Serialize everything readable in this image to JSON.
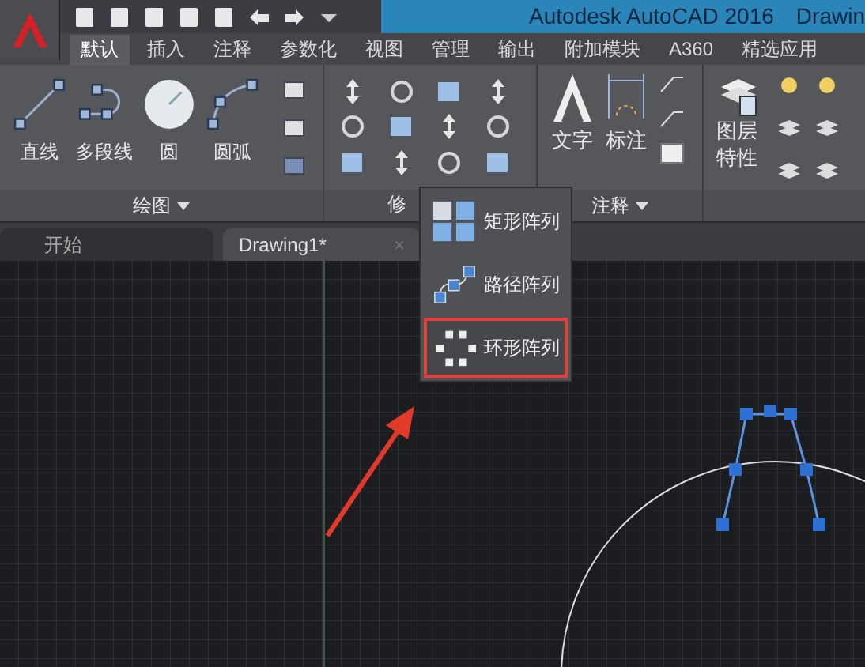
{
  "title_bar": {
    "title": "Autodesk AutoCAD 2016",
    "document": "Drawin"
  },
  "ribbon_tabs": [
    {
      "label": "默认",
      "selected": true
    },
    {
      "label": "插入",
      "selected": false
    },
    {
      "label": "注释",
      "selected": false
    },
    {
      "label": "参数化",
      "selected": false
    },
    {
      "label": "视图",
      "selected": false
    },
    {
      "label": "管理",
      "selected": false
    },
    {
      "label": "输出",
      "selected": false
    },
    {
      "label": "附加模块",
      "selected": false
    },
    {
      "label": "A360",
      "selected": false
    },
    {
      "label": "精选应用",
      "selected": false
    }
  ],
  "draw_panel": {
    "title": "绘图",
    "tools": [
      "直线",
      "多段线",
      "圆",
      "圆弧"
    ]
  },
  "modify_panel": {
    "title": "修"
  },
  "annotation_panel": {
    "title": "注释",
    "tools": [
      "文字",
      "标注"
    ]
  },
  "layers_panel": {
    "tools": [
      "图层特性"
    ]
  },
  "file_tabs": [
    {
      "label": "开始",
      "selected": false
    },
    {
      "label": "Drawing1*",
      "selected": true,
      "close": "×"
    }
  ],
  "array_menu": [
    {
      "kind": "rectangular",
      "label": "矩形阵列",
      "highlighted": false
    },
    {
      "kind": "path",
      "label": "路径阵列",
      "highlighted": false
    },
    {
      "kind": "polar",
      "label": "环形阵列",
      "highlighted": true
    }
  ]
}
